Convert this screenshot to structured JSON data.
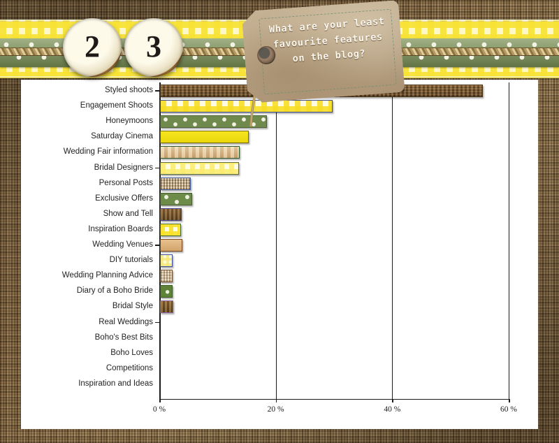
{
  "header": {
    "badges": [
      "2",
      "3"
    ],
    "question": "What are your least favourite features on the blog?"
  },
  "chart_data": {
    "type": "bar",
    "orientation": "horizontal",
    "title": "What are your least favourite features on the blog?",
    "xlabel": "",
    "ylabel": "",
    "xlim": [
      0,
      60
    ],
    "grid": true,
    "legend": "none",
    "xticks": [
      "0 %",
      "20 %",
      "40 %",
      "60 %"
    ],
    "xtick_values": [
      0,
      20,
      40,
      60
    ],
    "categories": [
      "Styled shoots",
      "Engagement Shoots",
      "Honeymoons",
      "Saturday Cinema",
      "Wedding Fair information",
      "Bridal Designers",
      "Personal Posts",
      "Exclusive Offers",
      "Show and Tell",
      "Inspiration Boards",
      "Wedding Venues",
      "DIY tutorials",
      "Wedding Planning Advice",
      "Diary of a Boho Bride",
      "Bridal Style",
      "Real Weddings",
      "Boho's Best Bits",
      "Boho Loves",
      "Competitions",
      "Inspiration and Ideas"
    ],
    "values": [
      55.2,
      29.4,
      18.1,
      15.0,
      13.4,
      13.3,
      5.0,
      5.3,
      3.5,
      3.4,
      3.6,
      1.9,
      1.9,
      1.9,
      2.0,
      0,
      0,
      0,
      0,
      0
    ],
    "bar_styles": [
      "p-wood-dark",
      "p-gingham-yellow",
      "p-green-dot",
      "p-solid-yellow",
      "p-wood-light",
      "p-gingham-pale",
      "p-burlap",
      "p-green-dot2",
      "p-wood-med",
      "p-gingham-bright",
      "p-wood-tan",
      "p-pale-yellow-grid",
      "p-burlap-light",
      "p-green-solid",
      "p-wood-rust",
      "p-wood-dark",
      "p-wood-dark",
      "p-wood-dark",
      "p-wood-dark",
      "p-wood-dark"
    ]
  },
  "colors": {
    "background": "#9b7b50",
    "panel": "#ffffff",
    "ribbon_yellow": "#f7e234",
    "ribbon_green": "#7d9457",
    "axis": "#1b1b1b",
    "label_text": "#232323",
    "tag_paper": "#b9a384"
  }
}
